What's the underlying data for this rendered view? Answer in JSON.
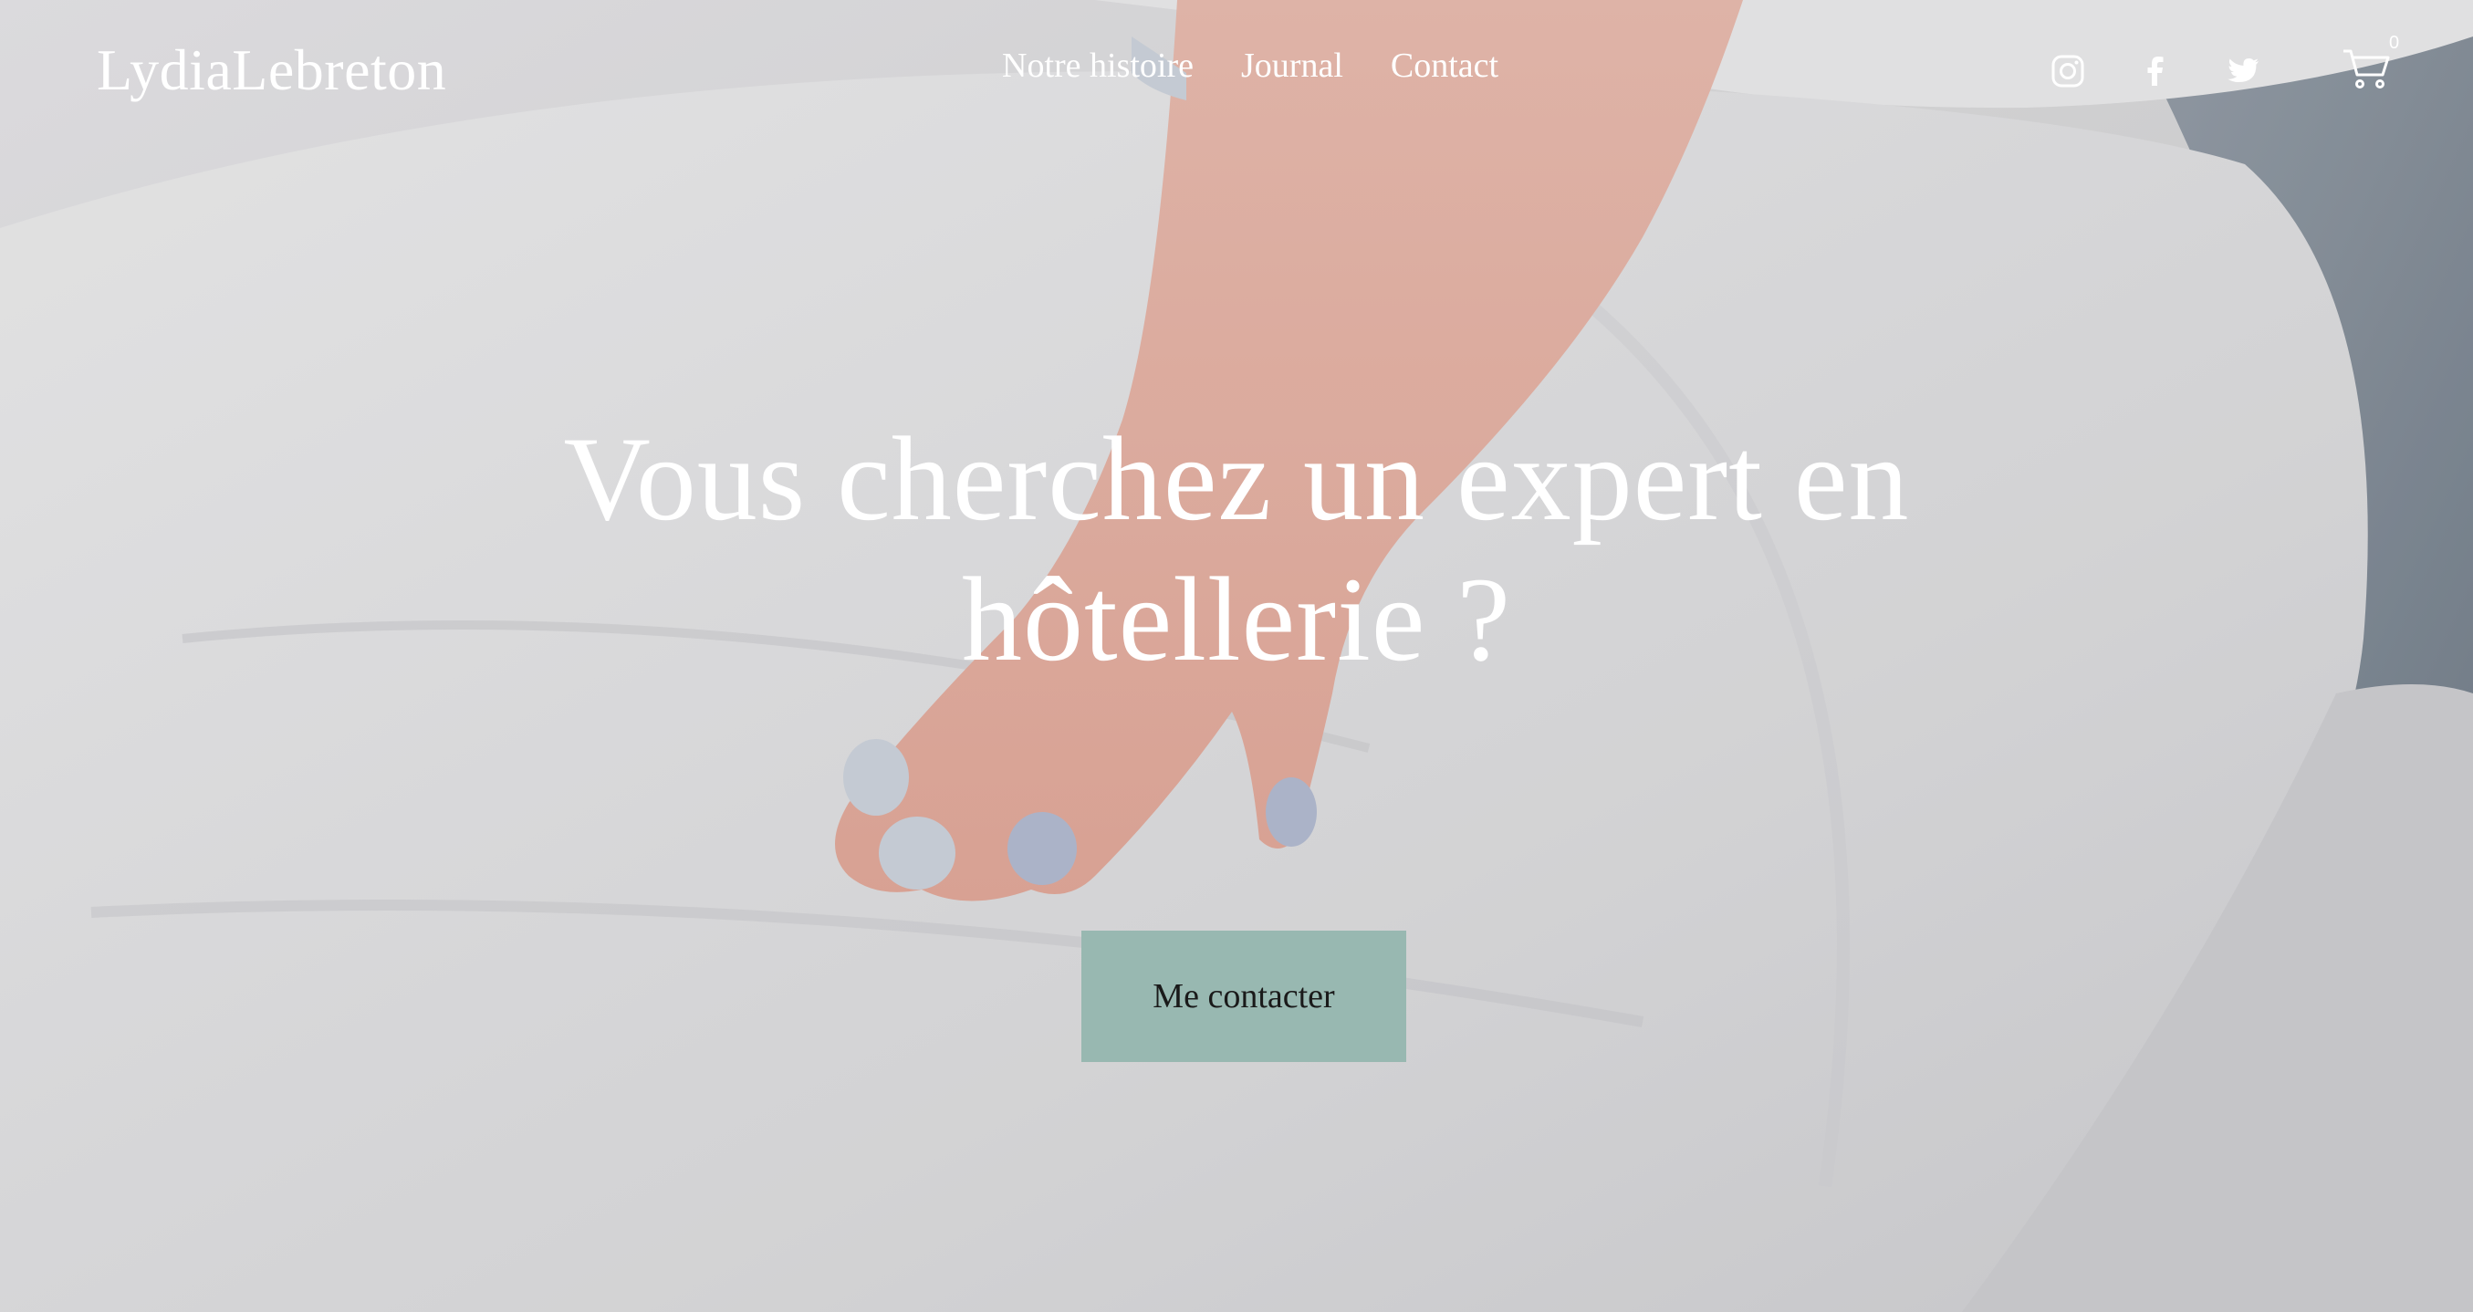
{
  "site": {
    "logo": "LydiaLebreton"
  },
  "nav": {
    "items": [
      {
        "label": "Notre histoire"
      },
      {
        "label": "Journal"
      },
      {
        "label": "Contact"
      }
    ]
  },
  "social": {
    "icons": [
      "instagram-icon",
      "facebook-icon",
      "twitter-icon"
    ]
  },
  "cart": {
    "icon": "cart-icon",
    "count": "0"
  },
  "hero": {
    "headline_line1": "Vous cherchez un expert en",
    "headline_line2": "hôtellerie ?",
    "cta_label": "Me contacter",
    "cta_color": "#98b8b1"
  }
}
